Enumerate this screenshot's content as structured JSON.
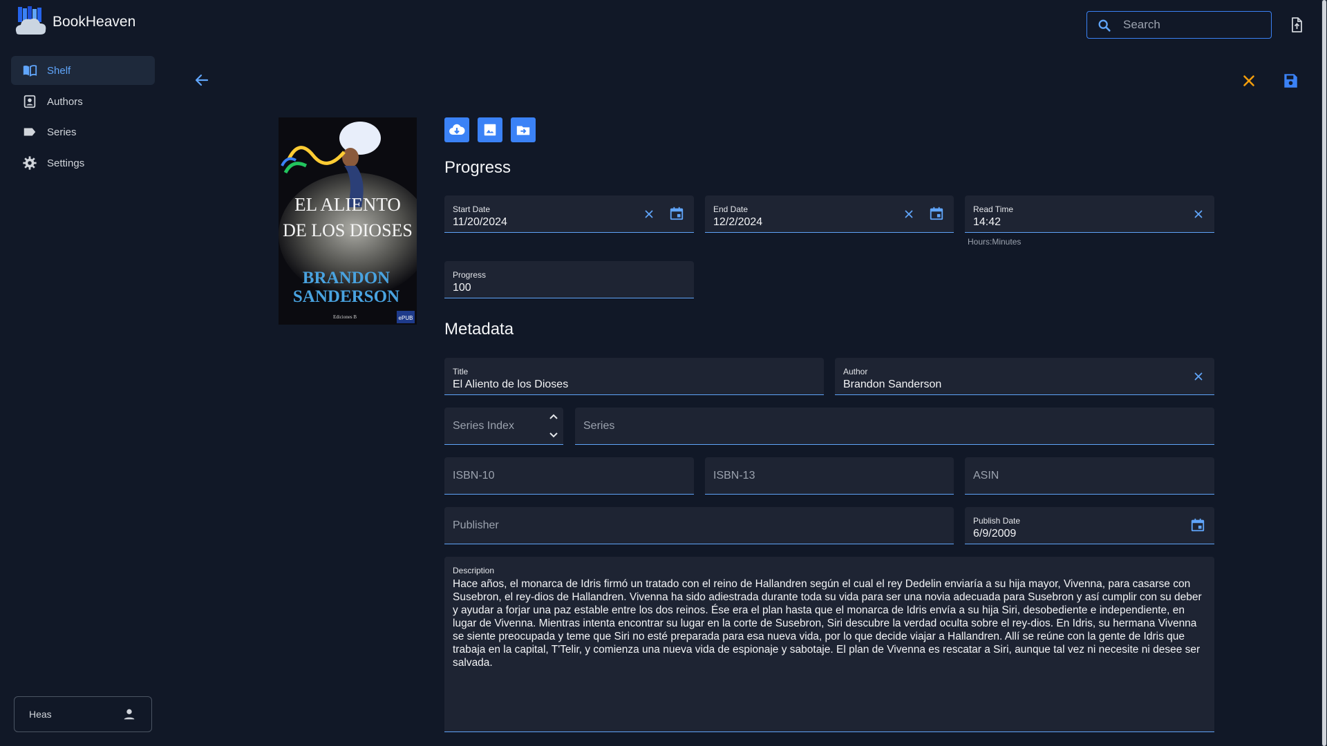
{
  "app": {
    "title": "BookHeaven"
  },
  "search": {
    "placeholder": "Search"
  },
  "sidebar": {
    "items": [
      {
        "label": "Shelf",
        "icon": "book-open-icon",
        "active": true
      },
      {
        "label": "Authors",
        "icon": "contact-card-icon",
        "active": false
      },
      {
        "label": "Series",
        "icon": "label-tag-icon",
        "active": false
      },
      {
        "label": "Settings",
        "icon": "gear-icon",
        "active": false
      }
    ],
    "user": {
      "name": "Heas",
      "icon": "person-icon"
    }
  },
  "cover": {
    "title_line1": "EL ALIENTO",
    "title_line2": "DE LOS DIOSES",
    "author_line1": "BRANDON",
    "author_line2": "SANDERSON",
    "publisher": "Ediciones B",
    "badge": "ePUB"
  },
  "progress": {
    "heading": "Progress",
    "start_date": {
      "label": "Start Date",
      "value": "11/20/2024"
    },
    "end_date": {
      "label": "End Date",
      "value": "12/2/2024"
    },
    "read_time": {
      "label": "Read Time",
      "value": "14:42",
      "hint": "Hours:Minutes"
    },
    "progress": {
      "label": "Progress",
      "value": "100"
    }
  },
  "metadata": {
    "heading": "Metadata",
    "title": {
      "label": "Title",
      "value": "El Aliento de los Dioses"
    },
    "author": {
      "label": "Author",
      "value": "Brandon Sanderson"
    },
    "series_index": {
      "placeholder": "Series Index"
    },
    "series": {
      "placeholder": "Series"
    },
    "isbn10": {
      "placeholder": "ISBN-10"
    },
    "isbn13": {
      "placeholder": "ISBN-13"
    },
    "asin": {
      "placeholder": "ASIN"
    },
    "publisher": {
      "placeholder": "Publisher"
    },
    "publish_date": {
      "label": "Publish Date",
      "value": "6/9/2009"
    },
    "description": {
      "label": "Description",
      "value": "Hace años, el monarca de Idris firmó un tratado con el reino de Hallandren según el cual el rey Dedelin enviaría a su hija mayor, Vivenna, para casarse con Susebron, el rey-dios de Hallandren. Vivenna ha sido adiestrada durante toda su vida para ser una novia adecuada para Susebron y así cumplir con su deber y ayudar a forjar una paz estable entre los dos reinos. Ése era el plan hasta que el monarca de Idris envía a su hija Siri, desobediente e independiente, en lugar de Vivenna. Mientras intenta encontrar su lugar en la corte de Susebron, Siri descubre la verdad oculta sobre el rey-dios. En Idris, su hermana Vivenna se siente preocupada y teme que Siri no esté preparada para esa nueva vida, por lo que decide viajar a Hallandren. Allí se reúne con la gente de Idris que trabaja en la capital, T'Telir, y comienza una nueva vida de espionaje y sabotaje. El plan de Vivenna es rescatar a Siri, aunque tal vez ni necesite ni desee ser salvada."
    }
  },
  "colors": {
    "accent": "#3b82f6",
    "background": "#111827",
    "field": "#1e2433",
    "close_icon": "#f59e0b"
  }
}
